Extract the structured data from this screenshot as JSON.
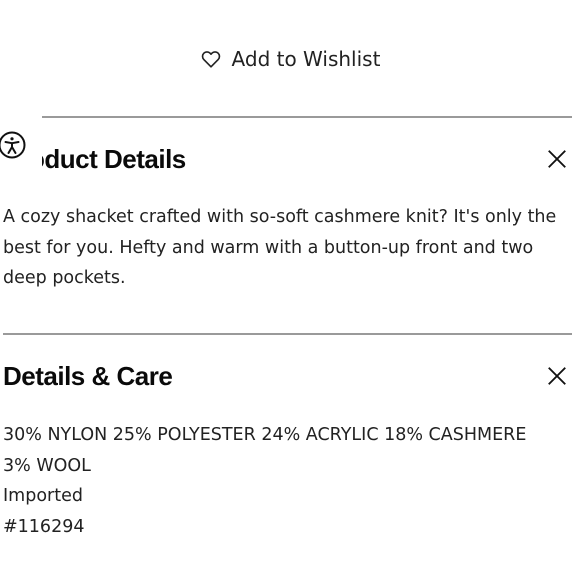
{
  "wishlist": {
    "label": "Add to Wishlist",
    "icon": "heart-outline-icon"
  },
  "sections": [
    {
      "title": "Product Details",
      "visible_title": "oduct Details",
      "close_icon": "close-icon",
      "body": "A cozy shacket crafted with so-soft cashmere knit? It's only the best for you. Hefty and warm with a button-up front and two deep pockets."
    },
    {
      "title": "Details & Care",
      "close_icon": "close-icon",
      "lines": [
        "30% NYLON 25% POLYESTER 24% ACRYLIC 18% CASHMERE",
        "3% WOOL",
        "Imported",
        "#116294"
      ]
    }
  ],
  "accessibility_widget": {
    "icon": "accessibility-icon"
  }
}
